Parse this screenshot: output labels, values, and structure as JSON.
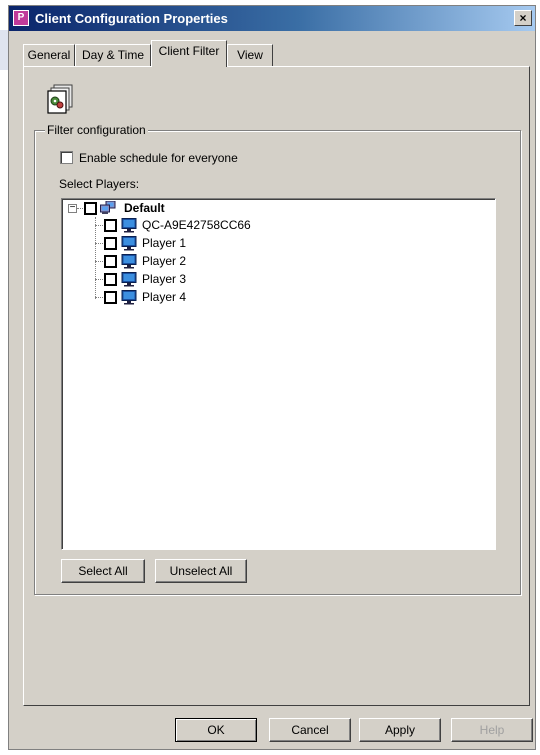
{
  "window": {
    "title": "Client Configuration Properties",
    "close_label": "×"
  },
  "tabs": [
    {
      "label": "General",
      "active": false
    },
    {
      "label": "Day & Time",
      "active": false
    },
    {
      "label": "Client Filter",
      "active": true
    },
    {
      "label": "View",
      "active": false
    }
  ],
  "filter": {
    "group_label": "Filter configuration",
    "schedule_checkbox_label": "Enable schedule for everyone",
    "schedule_checked": false,
    "select_players_label": "Select Players:",
    "tree": {
      "root": {
        "label": "Default",
        "expanded": true,
        "expander": "−",
        "checked": false,
        "icon": "network-computers-icon"
      },
      "children": [
        {
          "label": "QC-A9E42758CC66",
          "checked": false,
          "icon": "monitor-icon"
        },
        {
          "label": "Player 1",
          "checked": false,
          "icon": "monitor-icon"
        },
        {
          "label": "Player 2",
          "checked": false,
          "icon": "monitor-icon"
        },
        {
          "label": "Player 3",
          "checked": false,
          "icon": "monitor-icon"
        },
        {
          "label": "Player 4",
          "checked": false,
          "icon": "monitor-icon"
        }
      ]
    },
    "select_all_label": "Select All",
    "unselect_all_label": "Unselect All"
  },
  "footer": {
    "ok_label": "OK",
    "cancel_label": "Cancel",
    "apply_label": "Apply",
    "help_label": "Help",
    "help_disabled": true
  },
  "colors": {
    "dialog_face": "#d4d0c8",
    "title_gradient_start": "#0a246a",
    "title_gradient_end": "#a6caf0",
    "monitor_screen": "#3c8fe0"
  }
}
